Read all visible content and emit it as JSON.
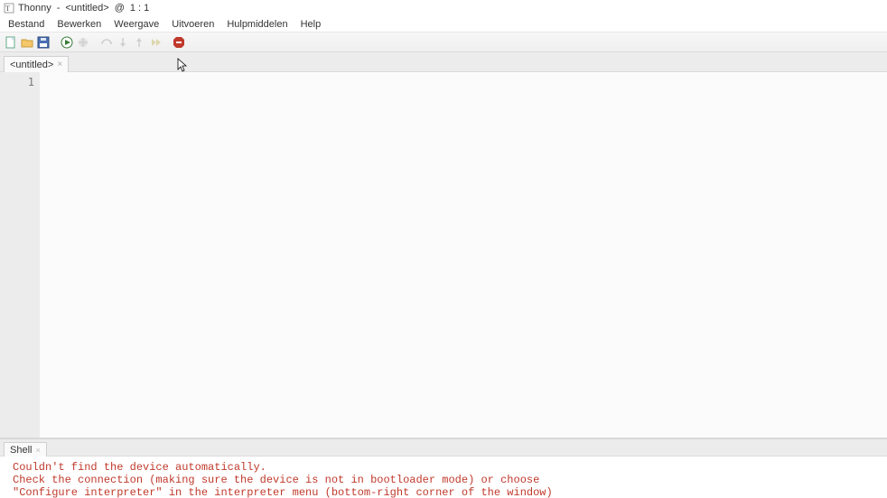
{
  "title": {
    "app": "Thonny",
    "sep": "-",
    "doc": "<untitled>",
    "at": "@",
    "pos": "1 : 1"
  },
  "menu": {
    "items": [
      "Bestand",
      "Bewerken",
      "Weergave",
      "Uitvoeren",
      "Hulpmiddelen",
      "Help"
    ]
  },
  "toolbar": {
    "icons": [
      "new-file-icon",
      "open-file-icon",
      "save-file-icon",
      "run-icon",
      "debug-icon",
      "step-over-icon",
      "step-into-icon",
      "step-out-icon",
      "resume-icon",
      "stop-icon"
    ]
  },
  "tabs": {
    "editor": {
      "label": "<untitled>"
    }
  },
  "editor": {
    "line1": "1"
  },
  "shell": {
    "tab_label": "Shell",
    "lines": [
      "Couldn't find the device automatically. ",
      "Check the connection (making sure the device is not in bootloader mode) or choose",
      "\"Configure interpreter\" in the interpreter menu (bottom-right corner of the window)"
    ]
  }
}
